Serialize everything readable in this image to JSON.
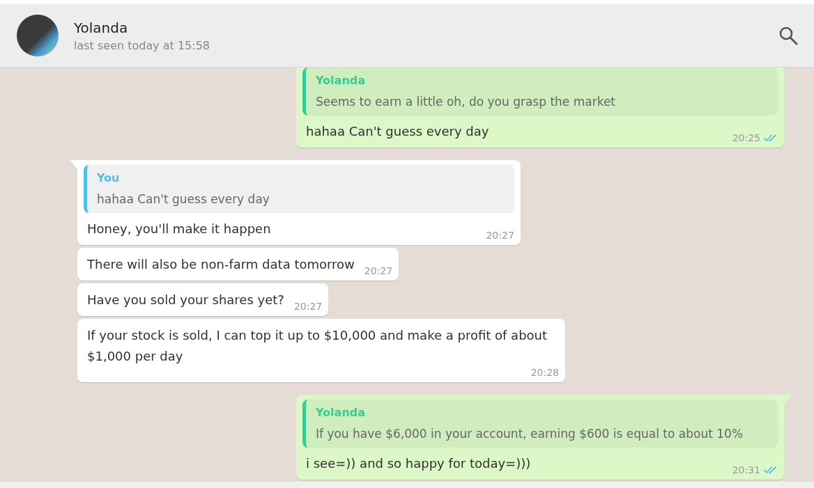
{
  "header": {
    "name": "Yolanda",
    "status": "last seen today at 15:58"
  },
  "messages": [
    {
      "kind": "outgoing",
      "tail": false,
      "quote": {
        "author": "Yolanda",
        "text": "Seems to earn a little oh, do you grasp the market",
        "color": "#35cd96"
      },
      "text": "hahaa Can't guess every day",
      "time": "20:25",
      "read": true
    },
    {
      "kind": "incoming",
      "tail": true,
      "quote": {
        "author": "You",
        "text": "hahaa Can't guess every day",
        "color": "#53bdeb"
      },
      "text": "Honey, you'll make it happen",
      "time": "20:27"
    },
    {
      "kind": "incoming",
      "tail": false,
      "text": "There will also be non-farm data tomorrow",
      "time": "20:27"
    },
    {
      "kind": "incoming",
      "tail": false,
      "text": "Have you sold your shares yet?",
      "time": "20:27"
    },
    {
      "kind": "incoming",
      "tail": false,
      "text": "If your stock is sold, I can top it up to $10,000 and make a profit of about $1,000 per day",
      "time": "20:28"
    },
    {
      "kind": "outgoing",
      "tail": true,
      "quote": {
        "author": "Yolanda",
        "text": "If you have $6,000 in your account, earning $600 is equal to about 10%",
        "color": "#35cd96"
      },
      "text": "i see=)) and so happy for today=)))",
      "time": "20:31",
      "read": true
    }
  ]
}
